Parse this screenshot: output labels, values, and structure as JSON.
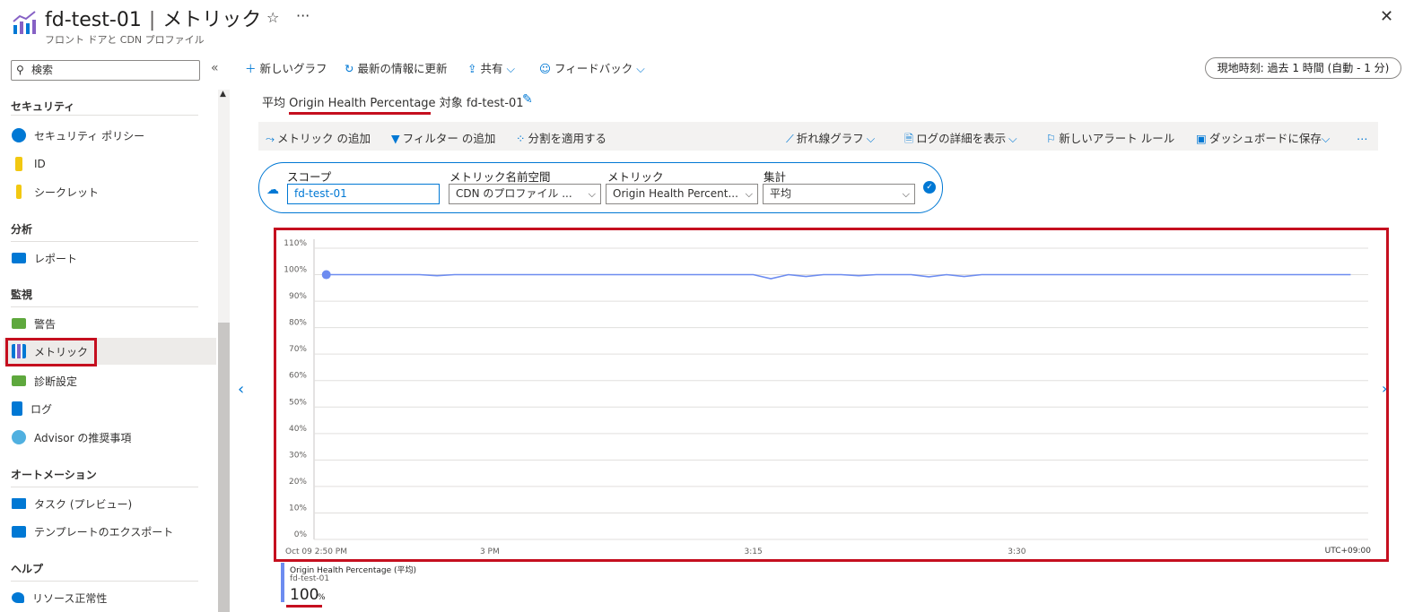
{
  "header": {
    "resource": "fd-test-01",
    "blade": "メトリック",
    "subtitle": "フロント ドアと CDN プロファイル",
    "star_icon": "star-icon",
    "more_icon": "more-icon",
    "close_icon": "close-icon"
  },
  "sidebar": {
    "search_placeholder": "検索",
    "sections": [
      {
        "title": "セキュリティ",
        "items": [
          {
            "label": "セキュリティ ポリシー",
            "icon": "security-policy-icon"
          },
          {
            "label": "ID",
            "icon": "identity-key-icon"
          },
          {
            "label": "シークレット",
            "icon": "secret-key-icon"
          }
        ]
      },
      {
        "title": "分析",
        "items": [
          {
            "label": "レポート",
            "icon": "report-icon"
          }
        ]
      },
      {
        "title": "監視",
        "items": [
          {
            "label": "警告",
            "icon": "alert-icon"
          },
          {
            "label": "メトリック",
            "icon": "metrics-icon",
            "active": true
          },
          {
            "label": "診断設定",
            "icon": "diagnostic-icon"
          },
          {
            "label": "ログ",
            "icon": "logs-icon"
          },
          {
            "label": "Advisor の推奨事項",
            "icon": "advisor-icon"
          }
        ]
      },
      {
        "title": "オートメーション",
        "items": [
          {
            "label": "タスク (プレビュー)",
            "icon": "tasks-icon"
          },
          {
            "label": "テンプレートのエクスポート",
            "icon": "export-template-icon"
          }
        ]
      },
      {
        "title": "ヘルプ",
        "items": [
          {
            "label": "リソース正常性",
            "icon": "resource-health-icon"
          }
        ]
      }
    ]
  },
  "toolbar": {
    "new_chart": "新しいグラフ",
    "refresh": "最新の情報に更新",
    "share": "共有",
    "feedback": "フィードバック",
    "time_range": "現地時刻: 過去 1 時間 (自動 - 1 分)"
  },
  "chart_heading": {
    "aggregation": "平均",
    "metric": "Origin Health Percentage",
    "target_label": "対象",
    "target": "fd-test-01"
  },
  "chart_toolbar": {
    "add_metric": "メトリック の追加",
    "add_filter": "フィルター の追加",
    "apply_split": "分割を適用する",
    "line_chart": "折れ線グラフ",
    "drill_logs": "ログの詳細を表示",
    "new_alert": "新しいアラート ルール",
    "save_dashboard": "ダッシュボードに保存",
    "more": "…"
  },
  "scope": {
    "scope_label": "スコープ",
    "scope_value": "fd-test-01",
    "namespace_label": "メトリック名前空間",
    "namespace_value": "CDN のプロファイル ...",
    "metric_label": "メトリック",
    "metric_value": "Origin Health Percent...",
    "aggregation_label": "集計",
    "aggregation_value": "平均"
  },
  "chart_data": {
    "type": "line",
    "y_ticks": [
      "0%",
      "10%",
      "20%",
      "30%",
      "40%",
      "50%",
      "60%",
      "70%",
      "80%",
      "90%",
      "100%",
      "110%"
    ],
    "ylim": [
      0,
      110
    ],
    "x_ticks": [
      {
        "label": "Oct 09 2:50 PM",
        "t": 0
      },
      {
        "label": "3 PM",
        "t": 10
      },
      {
        "label": "3:15",
        "t": 25
      },
      {
        "label": "3:30",
        "t": 40
      }
    ],
    "xlim": [
      0,
      60
    ],
    "timezone": "UTC+09:00",
    "grid": true,
    "series": [
      {
        "name": "Origin Health Percentage (平均)",
        "color": "#6d8cf0",
        "x": [
          0.7,
          6,
          7,
          8,
          25,
          26,
          27,
          28,
          29,
          30,
          31,
          32,
          33,
          34,
          35,
          36,
          37,
          38,
          39,
          40,
          59
        ],
        "y": [
          100,
          100,
          99.6,
          100,
          100,
          98.5,
          100,
          99.3,
          100,
          100,
          99.6,
          100,
          100,
          100,
          99.2,
          100,
          99.3,
          100,
          100,
          100,
          100
        ]
      }
    ]
  },
  "legend": {
    "name": "Origin Health Percentage (平均)",
    "resource": "fd-test-01",
    "value": "100",
    "unit": "%"
  }
}
